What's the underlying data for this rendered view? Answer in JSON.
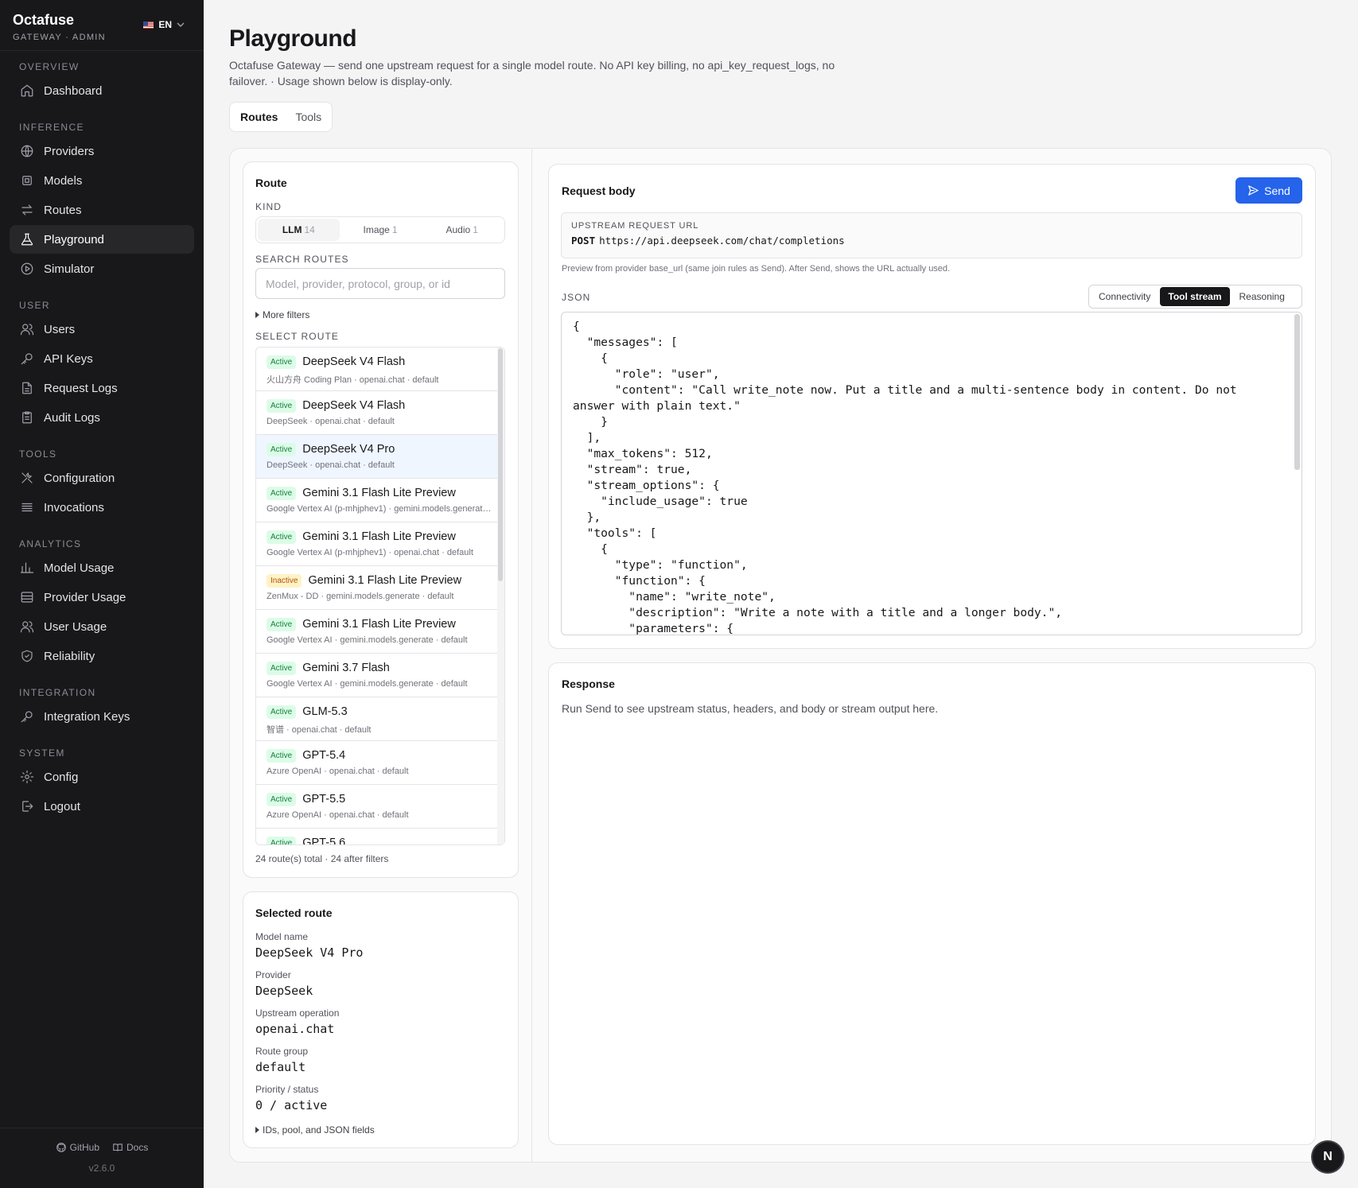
{
  "sidebar": {
    "brand": "Octafuse",
    "brand_sub": "GATEWAY · ADMIN",
    "lang": "EN",
    "sections": {
      "overview": "OVERVIEW",
      "inference": "INFERENCE",
      "user": "USER",
      "tools": "TOOLS",
      "analytics": "ANALYTICS",
      "integration": "INTEGRATION",
      "system": "SYSTEM"
    },
    "items": {
      "dashboard": "Dashboard",
      "providers": "Providers",
      "models": "Models",
      "routes": "Routes",
      "playground": "Playground",
      "simulator": "Simulator",
      "users": "Users",
      "api_keys": "API Keys",
      "request_logs": "Request Logs",
      "audit_logs": "Audit Logs",
      "configuration": "Configuration",
      "invocations": "Invocations",
      "model_usage": "Model Usage",
      "provider_usage": "Provider Usage",
      "user_usage": "User Usage",
      "reliability": "Reliability",
      "integration_keys": "Integration Keys",
      "config": "Config",
      "logout": "Logout"
    },
    "footer": {
      "github": "GitHub",
      "docs": "Docs",
      "version": "v2.6.0"
    }
  },
  "page": {
    "title": "Playground",
    "description": "Octafuse Gateway — send one upstream request for a single model route. No API key billing, no api_key_request_logs, no failover. · Usage shown below is display-only.",
    "tabs": [
      "Routes",
      "Tools"
    ]
  },
  "route": {
    "title": "Route",
    "kind_label": "KIND",
    "kinds": [
      {
        "label": "LLM",
        "count": "14"
      },
      {
        "label": "Image",
        "count": "1"
      },
      {
        "label": "Audio",
        "count": "1"
      }
    ],
    "search_label": "SEARCH ROUTES",
    "search_placeholder": "Model, provider, protocol, group, or id",
    "more_filters": "More filters",
    "select_label": "SELECT ROUTE",
    "items": [
      {
        "status": "Active",
        "name": "DeepSeek V4 Flash",
        "sub": "火山方舟 Coding Plan · openai.chat · default"
      },
      {
        "status": "Active",
        "name": "DeepSeek V4 Flash",
        "sub": "DeepSeek · openai.chat · default"
      },
      {
        "status": "Active",
        "name": "DeepSeek V4 Pro",
        "sub": "DeepSeek · openai.chat · default"
      },
      {
        "status": "Active",
        "name": "Gemini 3.1 Flash Lite Preview",
        "sub": "Google Vertex AI (p-mhjphev1) · gemini.models.generate · default"
      },
      {
        "status": "Active",
        "name": "Gemini 3.1 Flash Lite Preview",
        "sub": "Google Vertex AI (p-mhjphev1) · openai.chat · default"
      },
      {
        "status": "Inactive",
        "name": "Gemini 3.1 Flash Lite Preview",
        "sub": "ZenMux - DD · gemini.models.generate · default"
      },
      {
        "status": "Active",
        "name": "Gemini 3.1 Flash Lite Preview",
        "sub": "Google Vertex AI · gemini.models.generate · default"
      },
      {
        "status": "Active",
        "name": "Gemini 3.7 Flash",
        "sub": "Google Vertex AI · gemini.models.generate · default"
      },
      {
        "status": "Active",
        "name": "GLM-5.3",
        "sub": "智谱 · openai.chat · default"
      },
      {
        "status": "Active",
        "name": "GPT-5.4",
        "sub": "Azure OpenAI · openai.chat · default"
      },
      {
        "status": "Active",
        "name": "GPT-5.5",
        "sub": "Azure OpenAI · openai.chat · default"
      },
      {
        "status": "Active",
        "name": "GPT-5.6 ",
        "sub": ""
      }
    ],
    "count_text": "24 route(s) total · 24 after filters"
  },
  "selected": {
    "title": "Selected route",
    "fields": [
      {
        "label": "Model name",
        "value": "DeepSeek V4 Pro"
      },
      {
        "label": "Provider",
        "value": "DeepSeek"
      },
      {
        "label": "Upstream operation",
        "value": "openai.chat"
      },
      {
        "label": "Route group",
        "value": "default"
      },
      {
        "label": "Priority / status",
        "value": "0 / active"
      }
    ],
    "ids_toggle": "IDs, pool, and JSON fields"
  },
  "request": {
    "title": "Request body",
    "send": "Send",
    "url_caption": "UPSTREAM REQUEST URL",
    "method": "POST",
    "url": "https://api.deepseek.com/chat/completions",
    "note": "Preview from provider base_url (same join rules as Send). After Send, shows the URL actually used.",
    "json_label": "JSON",
    "presets": [
      "Connectivity",
      "Tool stream",
      "Reasoning"
    ],
    "active_preset": "Tool stream",
    "body": "{\n  \"messages\": [\n    {\n      \"role\": \"user\",\n      \"content\": \"Call write_note now. Put a title and a multi-sentence body in content. Do not answer with plain text.\"\n    }\n  ],\n  \"max_tokens\": 512,\n  \"stream\": true,\n  \"stream_options\": {\n    \"include_usage\": true\n  },\n  \"tools\": [\n    {\n      \"type\": \"function\",\n      \"function\": {\n        \"name\": \"write_note\",\n        \"description\": \"Write a note with a title and a longer body.\",\n        \"parameters\": {"
  },
  "response": {
    "title": "Response",
    "placeholder": "Run Send to see upstream status, headers, and body or stream output here."
  },
  "fab": "N"
}
